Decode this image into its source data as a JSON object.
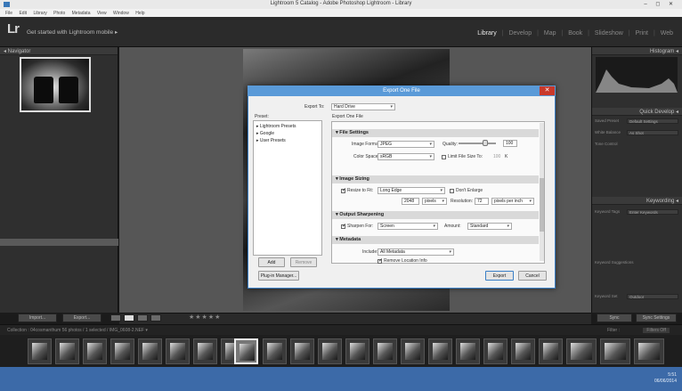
{
  "window": {
    "title": "Lightroom 5 Catalog - Adobe Photoshop Lightroom - Library",
    "controls": "– ◻ ✕"
  },
  "menu": [
    "File",
    "Edit",
    "Library",
    "Photo",
    "Metadata",
    "View",
    "Window",
    "Help"
  ],
  "identity": {
    "logo": "Lr",
    "mobile_text": "Get started with Lightroom mobile ▸"
  },
  "modules": {
    "library": "Library",
    "develop": "Develop",
    "map": "Map",
    "book": "Book",
    "slideshow": "Slideshow",
    "print": "Print",
    "web": "Web",
    "sep": "|"
  },
  "left_panel": {
    "navigator_title": "◂ Navigator",
    "import_button": "Import...",
    "export_button": "Export..."
  },
  "right_panel": {
    "histogram_title": "Histogram ◂",
    "quick_develop_title": "Quick Develop ◂",
    "keywording_title": "Keywording ◂",
    "saved_preset_label": "Saved Preset",
    "saved_preset_value": "Default Settings",
    "white_balance_label": "White Balance",
    "white_balance_value": "As Shot",
    "tone_control_label": "Tone Control",
    "keyword_tags_label": "Keyword Tags",
    "keyword_tags_value": "Enter Keywords",
    "keyword_suggestions_label": "Keyword Suggestions",
    "keyword_set_label": "Keyword Set",
    "keyword_set_value": "Outdoor",
    "sync_button": "Sync",
    "sync_settings_button": "Sync Settings"
  },
  "filmstrip": {
    "bar_text": "Collection : 04cosmanthum    56 photos / 1 selected / IMG_0608-2.NEF ▾",
    "filter_label": "Filter :",
    "filter_value": "Filters Off"
  },
  "dialog": {
    "title": "Export One File",
    "close": "✕",
    "export_to_label": "Export To:",
    "export_to_value": "Hard Drive",
    "preset_header": "Preset:",
    "settings_header": "Export One File",
    "presets": [
      "▸ Lightroom Presets",
      "▸ Google",
      "▸ User Presets"
    ],
    "add_button": "Add",
    "remove_button": "Remove",
    "plugin_button": "Plug-in Manager...",
    "export_button": "Export",
    "cancel_button": "Cancel",
    "file_settings": {
      "title": "▾ File Settings",
      "image_format_label": "Image Format:",
      "image_format_value": "JPEG",
      "quality_label": "Quality:",
      "quality_value": "100",
      "color_space_label": "Color Space:",
      "color_space_value": "sRGB",
      "limit_label": "Limit File Size To:",
      "limit_value": "100",
      "limit_unit": "K"
    },
    "image_sizing": {
      "title": "▾ Image Sizing",
      "resize_label": "Resize to Fit:",
      "resize_value": "Long Edge",
      "dont_enlarge": "Don't Enlarge",
      "size_value": "2048",
      "size_unit": "pixels",
      "resolution_label": "Resolution:",
      "resolution_value": "72",
      "resolution_unit": "pixels per inch"
    },
    "output_sharpening": {
      "title": "▾ Output Sharpening",
      "sharpen_label": "Sharpen For:",
      "sharpen_value": "Screen",
      "amount_label": "Amount:",
      "amount_value": "Standard"
    },
    "metadata": {
      "title": "▾ Metadata",
      "include_label": "Include:",
      "include_value": "All Metadata",
      "remove_location": "Remove Location Info"
    }
  },
  "taskbar": {
    "clock_time": "5:51",
    "clock_date": "06/06/2014"
  },
  "colors": {
    "dialog_title": "#5a9ad8",
    "taskbar": "#3c6aa8",
    "close_button": "#c9382a"
  }
}
